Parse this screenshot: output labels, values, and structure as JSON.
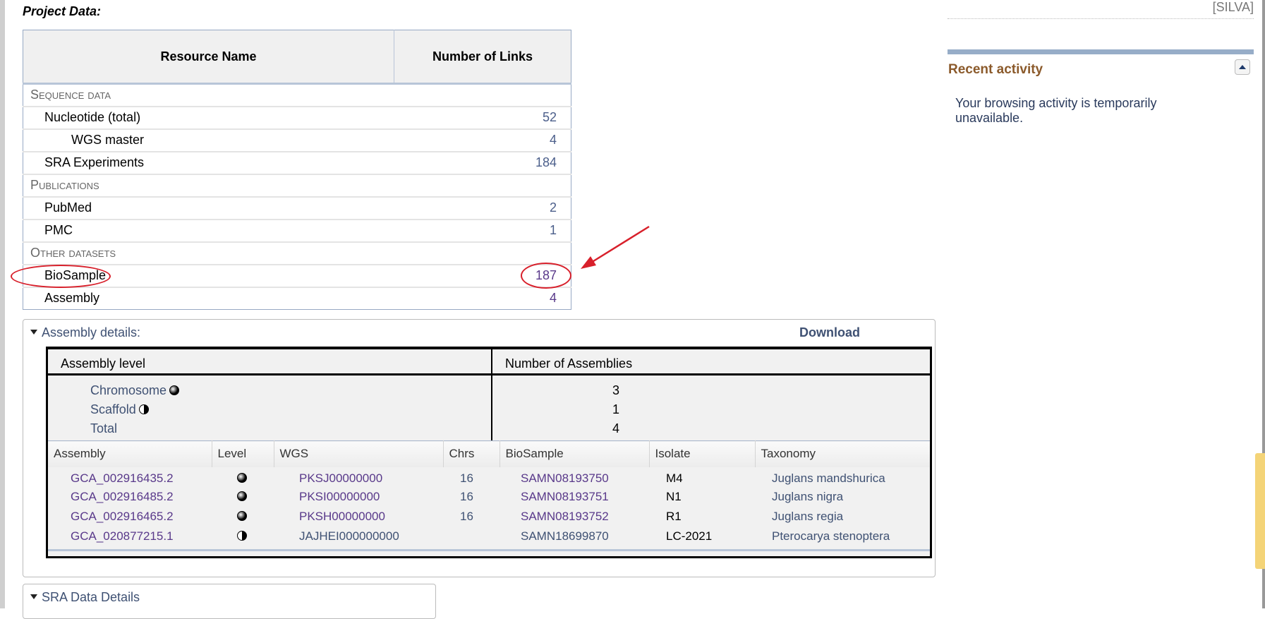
{
  "project": {
    "title": "Project Data:",
    "col_resource": "Resource Name",
    "col_links": "Number of Links",
    "rows": [
      {
        "type": "cat",
        "label": "Sequence data"
      },
      {
        "type": "item",
        "label": "Nucleotide (total)",
        "count": "52",
        "level": 1
      },
      {
        "type": "item",
        "label": "WGS master",
        "count": "4",
        "level": 2
      },
      {
        "type": "item",
        "label": "SRA Experiments",
        "count": "184",
        "level": 1
      },
      {
        "type": "cat",
        "label": "Publications"
      },
      {
        "type": "item",
        "label": "PubMed",
        "count": "2",
        "level": 1
      },
      {
        "type": "item",
        "label": "PMC",
        "count": "1",
        "level": 1
      },
      {
        "type": "cat",
        "label": "Other datasets"
      },
      {
        "type": "item",
        "label": "BioSample",
        "count": "187",
        "level": 1,
        "visited": true
      },
      {
        "type": "item",
        "label": "Assembly",
        "count": "4",
        "level": 1,
        "visited": true
      }
    ]
  },
  "assembly": {
    "title": "Assembly details:",
    "download": "Download",
    "summary_headers": [
      "Assembly level",
      "Number of Assemblies"
    ],
    "summary": [
      {
        "label": "Chromosome",
        "count": "3",
        "icon": "full-circle-icon"
      },
      {
        "label": "Scaffold",
        "count": "1",
        "icon": "half-circle-icon"
      },
      {
        "label": "Total",
        "count": "4"
      }
    ],
    "columns": [
      "Assembly",
      "Level",
      "WGS",
      "Chrs",
      "BioSample",
      "Isolate",
      "Taxonomy"
    ],
    "rows": [
      {
        "assembly": "GCA_002916435.2",
        "level": "chromosome",
        "wgs": "PKSJ00000000",
        "chrs": "16",
        "biosample": "SAMN08193750",
        "isolate": "M4",
        "taxonomy": "Juglans mandshurica"
      },
      {
        "assembly": "GCA_002916485.2",
        "level": "chromosome",
        "wgs": "PKSI00000000",
        "chrs": "16",
        "biosample": "SAMN08193751",
        "isolate": "N1",
        "taxonomy": "Juglans nigra"
      },
      {
        "assembly": "GCA_002916465.2",
        "level": "chromosome",
        "wgs": "PKSH00000000",
        "chrs": "16",
        "biosample": "SAMN08193752",
        "isolate": "R1",
        "taxonomy": "Juglans regia"
      },
      {
        "assembly": "GCA_020877215.1",
        "level": "scaffold",
        "wgs": "JAJHEI000000000",
        "chrs": "",
        "biosample": "SAMN18699870",
        "isolate": "LC-2021",
        "taxonomy": "Pterocarya stenoptera"
      }
    ]
  },
  "sra": {
    "title": "SRA Data Details"
  },
  "sidebar": {
    "silva": "[SILVA]",
    "recent_title": "Recent activity",
    "recent_text": "Your browsing activity is temporarily unavailable."
  },
  "colors": {
    "annotation": "#d8202b",
    "link": "#3f5173",
    "visited": "#59398a",
    "recent_title": "#8b5a2b"
  }
}
